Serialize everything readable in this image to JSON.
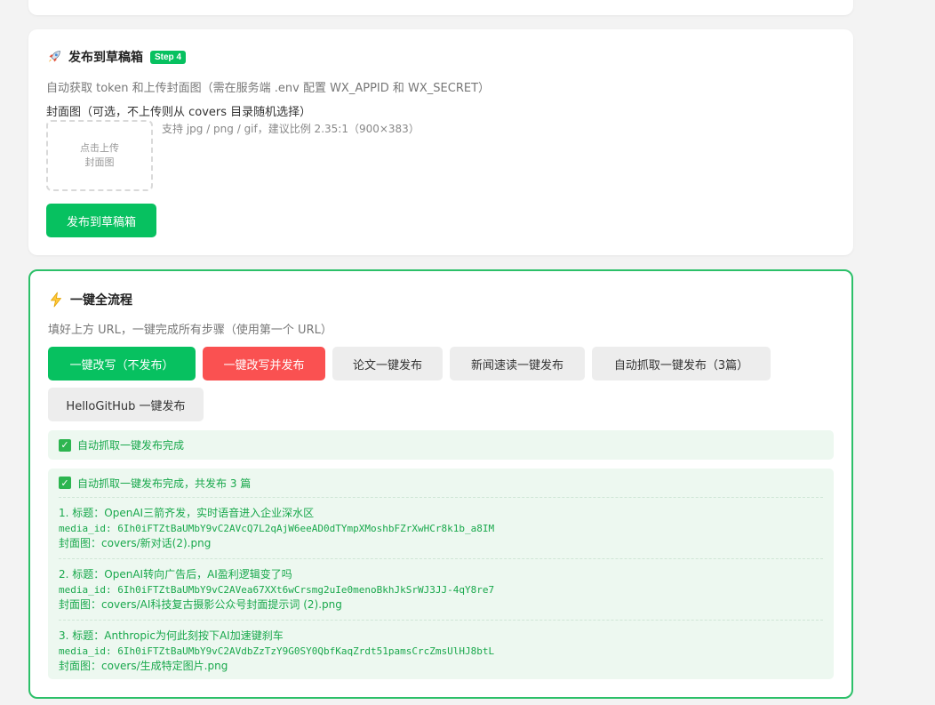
{
  "publish_card": {
    "icon": "rocket-icon",
    "title": "发布到草稿箱",
    "step_badge": "Step 4",
    "description": "自动获取 token 和上传封面图（需在服务端 .env 配置 WX_APPID 和 WX_SECRET）",
    "cover_label": "封面图（可选，不上传则从 covers 目录随机选择）",
    "upload_line1": "点击上传",
    "upload_line2": "封面图",
    "upload_hint": "支持 jpg / png / gif，建议比例 2.35:1（900×383）",
    "publish_button": "发布到草稿箱"
  },
  "flow_card": {
    "icon": "lightning-icon",
    "title": "一键全流程",
    "description": "填好上方 URL，一键完成所有步骤（使用第一个 URL）",
    "buttons": {
      "rewrite_only": "一键改写（不发布）",
      "rewrite_publish": "一键改写并发布",
      "paper_publish": "论文一键发布",
      "news_publish": "新闻速读一键发布",
      "auto_fetch_publish": "自动抓取一键发布（3篇）",
      "hellogithub_publish": "HelloGitHub 一键发布"
    },
    "status_text": "自动抓取一键发布完成",
    "result_head": "自动抓取一键发布完成，共发布 3 篇",
    "results": [
      {
        "title": "1. 标题：OpenAI三箭齐发，实时语音进入企业深水区",
        "media_id": "media_id: 6Ih0iFTZtBaUMbY9vC2AVcQ7L2qAjW6eeAD0dTYmpXMoshbFZrXwHCr8k1b_a8IM",
        "cover": "封面图：covers/新对话(2).png"
      },
      {
        "title": "2. 标题：OpenAI转向广告后，AI盈利逻辑变了吗",
        "media_id": "media_id: 6Ih0iFTZtBaUMbY9vC2AVea67XXt6wCrsmg2uIe0menoBkhJkSrWJ3JJ-4qY8re7",
        "cover": "封面图：covers/AI科技复古摄影公众号封面提示词 (2).png"
      },
      {
        "title": "3. 标题：Anthropic为何此刻按下AI加速键刹车",
        "media_id": "media_id: 6Ih0iFTZtBaUMbY9vC2AVdbZzTzY9G0SY0QbfKaqZrdt51pamsCrcZmsUlHJ8btL",
        "cover": "封面图：covers/生成特定图片.png"
      }
    ]
  },
  "colors": {
    "accent_green": "#07c160",
    "danger_red": "#fa5151",
    "success_text": "#19a84c",
    "success_bg": "#edf8f0"
  }
}
